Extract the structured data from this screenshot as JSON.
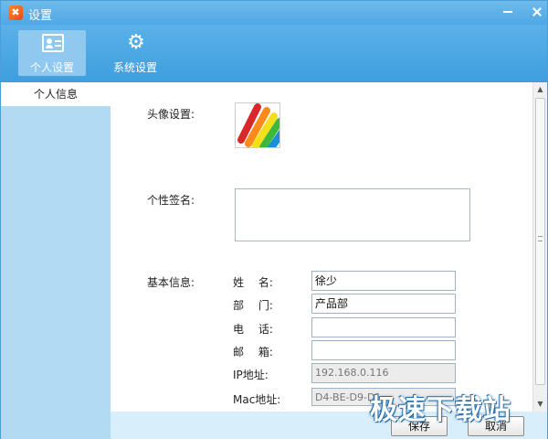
{
  "window": {
    "title": "设置"
  },
  "toolbar": {
    "tabs": [
      {
        "label": "个人设置",
        "icon": "contact-card-icon",
        "active": true
      },
      {
        "label": "系统设置",
        "icon": "gear-icon",
        "active": false
      }
    ]
  },
  "nav": {
    "items": [
      {
        "label": "个人信息",
        "selected": true
      }
    ]
  },
  "form": {
    "avatar_label": "头像设置:",
    "signature_label": "个性签名:",
    "signature_value": "",
    "basic_label": "基本信息:",
    "fields": [
      {
        "label": "姓　 名:",
        "value": "徐少",
        "readonly": false
      },
      {
        "label": "部　 门:",
        "value": "产品部",
        "readonly": false
      },
      {
        "label": "电　 话:",
        "value": "",
        "readonly": false
      },
      {
        "label": "邮　 箱:",
        "value": "",
        "readonly": false
      },
      {
        "label": "IP地址:",
        "value": "192.168.0.116",
        "readonly": true
      },
      {
        "label": "Mac地址:",
        "value": "D4-BE-D9-D1",
        "readonly": true
      }
    ]
  },
  "footer": {
    "save_label": "保存",
    "cancel_label": "取消"
  },
  "watermark": "极速下载站",
  "colors": {
    "titlebar": "#4ea8e4",
    "toolbar": "#3f9ede",
    "nav": "#b2daf3",
    "footer": "#d8eefb"
  }
}
